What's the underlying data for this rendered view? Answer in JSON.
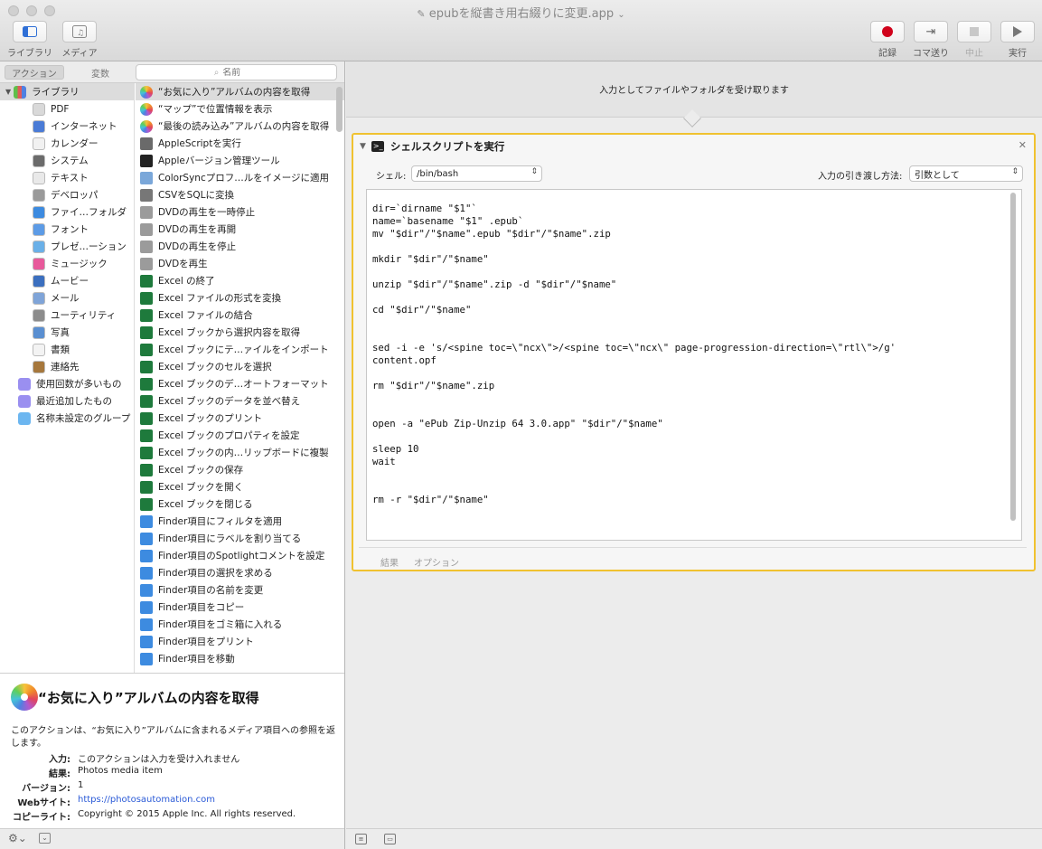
{
  "window": {
    "title": "epubを縦書き用右綴りに変更.app",
    "title_chevron": "⌄"
  },
  "toolbar": {
    "library_label": "ライブラリ",
    "media_label": "メディア",
    "record_label": "記録",
    "step_label": "コマ送り",
    "stop_label": "中止",
    "run_label": "実行"
  },
  "left_header": {
    "actions_tab": "アクション",
    "variables_tab": "変数",
    "search_placeholder": "名前"
  },
  "library": {
    "root": "ライブラリ",
    "categories": [
      {
        "label": "PDF",
        "color": "#d9d9d9",
        "icon": "pdf-icon"
      },
      {
        "label": "インターネット",
        "color": "#4a7bd6",
        "icon": "internet-icon"
      },
      {
        "label": "カレンダー",
        "color": "#f1f1f1",
        "icon": "calendar-icon"
      },
      {
        "label": "システム",
        "color": "#6b6b6b",
        "icon": "system-icon"
      },
      {
        "label": "テキスト",
        "color": "#e9e9e9",
        "icon": "text-icon"
      },
      {
        "label": "デベロッパ",
        "color": "#9a9a9a",
        "icon": "developer-icon"
      },
      {
        "label": "ファイ…フォルダ",
        "color": "#3d8be0",
        "icon": "finder-icon"
      },
      {
        "label": "フォント",
        "color": "#5c9be6",
        "icon": "font-icon"
      },
      {
        "label": "プレゼ…ーション",
        "color": "#6ab0e8",
        "icon": "presentation-icon"
      },
      {
        "label": "ミュージック",
        "color": "#e8599b",
        "icon": "music-icon"
      },
      {
        "label": "ムービー",
        "color": "#3b6fbf",
        "icon": "movie-icon"
      },
      {
        "label": "メール",
        "color": "#7fa4d8",
        "icon": "mail-icon"
      },
      {
        "label": "ユーティリティ",
        "color": "#8c8c8c",
        "icon": "utility-icon"
      },
      {
        "label": "写真",
        "color": "#5a8fd1",
        "icon": "photo-icon"
      },
      {
        "label": "書類",
        "color": "#f3f3f3",
        "icon": "document-icon"
      },
      {
        "label": "連絡先",
        "color": "#a6773c",
        "icon": "contacts-icon"
      }
    ],
    "smart_groups": [
      {
        "label": "使用回数が多いもの",
        "color": "#9a8ff0"
      },
      {
        "label": "最近追加したもの",
        "color": "#9a8ff0"
      },
      {
        "label": "名称未設定のグループ",
        "color": "#6cb6f0"
      }
    ]
  },
  "actions": [
    {
      "label": "“お気に入り”アルバムの内容を取得",
      "color": "#f2a33a",
      "icon": "photos-icon"
    },
    {
      "label": "“マップ”で位置情報を表示",
      "color": "#f2a33a",
      "icon": "photos-icon"
    },
    {
      "label": "“最後の読み込み”アルバムの内容を取得",
      "color": "#f2a33a",
      "icon": "photos-icon"
    },
    {
      "label": "AppleScriptを実行",
      "color": "#6a6a6a",
      "icon": "applescript-icon"
    },
    {
      "label": "Appleバージョン管理ツール",
      "color": "#222222",
      "icon": "terminal-icon"
    },
    {
      "label": "ColorSyncプロフ…ルをイメージに適用",
      "color": "#7aa7d9",
      "icon": "colorsync-icon"
    },
    {
      "label": "CSVをSQLに変換",
      "color": "#777777",
      "icon": "tools-icon"
    },
    {
      "label": "DVDの再生を一時停止",
      "color": "#9b9b9b",
      "icon": "dvd-icon"
    },
    {
      "label": "DVDの再生を再開",
      "color": "#9b9b9b",
      "icon": "dvd-icon"
    },
    {
      "label": "DVDの再生を停止",
      "color": "#9b9b9b",
      "icon": "dvd-icon"
    },
    {
      "label": "DVDを再生",
      "color": "#9b9b9b",
      "icon": "dvd-icon"
    },
    {
      "label": "Excel の終了",
      "color": "#1e7a3c",
      "icon": "excel-icon"
    },
    {
      "label": "Excel ファイルの形式を変換",
      "color": "#1e7a3c",
      "icon": "excel-icon"
    },
    {
      "label": "Excel ファイルの結合",
      "color": "#1e7a3c",
      "icon": "excel-icon"
    },
    {
      "label": "Excel ブックから選択内容を取得",
      "color": "#1e7a3c",
      "icon": "excel-icon"
    },
    {
      "label": "Excel ブックにテ…ァイルをインポート",
      "color": "#1e7a3c",
      "icon": "excel-icon"
    },
    {
      "label": "Excel ブックのセルを選択",
      "color": "#1e7a3c",
      "icon": "excel-icon"
    },
    {
      "label": "Excel ブックのデ…オートフォーマット",
      "color": "#1e7a3c",
      "icon": "excel-icon"
    },
    {
      "label": "Excel ブックのデータを並べ替え",
      "color": "#1e7a3c",
      "icon": "excel-icon"
    },
    {
      "label": "Excel ブックのプリント",
      "color": "#1e7a3c",
      "icon": "excel-icon"
    },
    {
      "label": "Excel ブックのプロパティを設定",
      "color": "#1e7a3c",
      "icon": "excel-icon"
    },
    {
      "label": "Excel ブックの内…リップボードに複製",
      "color": "#1e7a3c",
      "icon": "excel-icon"
    },
    {
      "label": "Excel ブックの保存",
      "color": "#1e7a3c",
      "icon": "excel-icon"
    },
    {
      "label": "Excel ブックを開く",
      "color": "#1e7a3c",
      "icon": "excel-icon"
    },
    {
      "label": "Excel ブックを閉じる",
      "color": "#1e7a3c",
      "icon": "excel-icon"
    },
    {
      "label": "Finder項目にフィルタを適用",
      "color": "#3d8be0",
      "icon": "finder-icon"
    },
    {
      "label": "Finder項目にラベルを割り当てる",
      "color": "#3d8be0",
      "icon": "finder-icon"
    },
    {
      "label": "Finder項目のSpotlightコメントを設定",
      "color": "#3d8be0",
      "icon": "finder-icon"
    },
    {
      "label": "Finder項目の選択を求める",
      "color": "#3d8be0",
      "icon": "finder-icon"
    },
    {
      "label": "Finder項目の名前を変更",
      "color": "#3d8be0",
      "icon": "finder-icon"
    },
    {
      "label": "Finder項目をコピー",
      "color": "#3d8be0",
      "icon": "finder-icon"
    },
    {
      "label": "Finder項目をゴミ箱に入れる",
      "color": "#3d8be0",
      "icon": "finder-icon"
    },
    {
      "label": "Finder項目をプリント",
      "color": "#3d8be0",
      "icon": "finder-icon"
    },
    {
      "label": "Finder項目を移動",
      "color": "#3d8be0",
      "icon": "finder-icon"
    }
  ],
  "description": {
    "title": "“お気に入り”アルバムの内容を取得",
    "text": "このアクションは、“お気に入り”アルバムに含まれるメディア項目への参照を返します。",
    "input_key": "入力:",
    "input_val": "このアクションは入力を受け入れません",
    "result_key": "結果:",
    "result_val": "Photos media item",
    "version_key": "バージョン:",
    "version_val": "1",
    "website_key": "Webサイト:",
    "website_val": "https://photosautomation.com",
    "copyright_key": "コピーライト:",
    "copyright_val": "Copyright © 2015 Apple Inc. All rights reserved."
  },
  "workflow": {
    "input_banner": "入力としてファイルやフォルダを受け取ります",
    "action": {
      "title": "シェルスクリプトを実行",
      "shell_label": "シェル:",
      "shell_value": "/bin/bash",
      "pass_label": "入力の引き渡し方法:",
      "pass_value": "引数として",
      "script": "dir=`dirname \"$1\"`\nname=`basename \"$1\" .epub`\nmv \"$dir\"/\"$name\".epub \"$dir\"/\"$name\".zip\n\nmkdir \"$dir\"/\"$name\"\n\nunzip \"$dir\"/\"$name\".zip -d \"$dir\"/\"$name\"\n\ncd \"$dir\"/\"$name\"\n\n\nsed -i -e 's/<spine toc=\\\"ncx\\\">/<spine toc=\\\"ncx\\\" page-progression-direction=\\\"rtl\\\">/g'\ncontent.opf\n\nrm \"$dir\"/\"$name\".zip\n\n\nopen -a \"ePub Zip-Unzip 64 3.0.app\" \"$dir\"/\"$name\"\n\nsleep 10\nwait\n\n\nrm -r \"$dir\"/\"$name\"",
      "results_tab": "結果",
      "options_tab": "オプション"
    }
  },
  "colors": {
    "accent_border": "#f0c230",
    "record_red": "#d0021b",
    "link": "#2a5ad7"
  }
}
